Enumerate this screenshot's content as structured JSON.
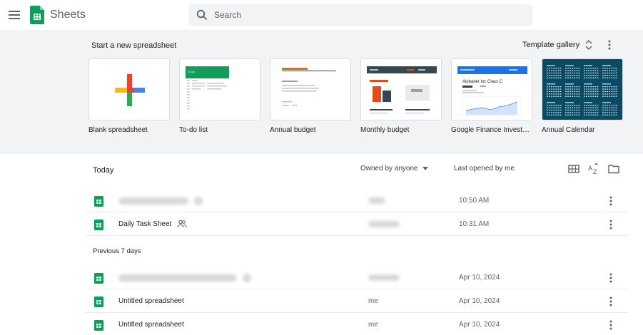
{
  "header": {
    "app_name": "Sheets",
    "search_placeholder": "Search"
  },
  "templates": {
    "title": "Start a new spreadsheet",
    "gallery_label": "Template gallery",
    "items": [
      {
        "label": "Blank spreadsheet"
      },
      {
        "label": "To-do list"
      },
      {
        "label": "Annual budget"
      },
      {
        "label": "Monthly budget"
      },
      {
        "label": "Google Finance Invest…"
      },
      {
        "label": "Annual Calendar"
      }
    ],
    "thumb_text": {
      "todo_title": "To-do",
      "finance_title": "Alphabet Inc Class C"
    }
  },
  "list": {
    "section_today": "Today",
    "owner_filter": "Owned by anyone",
    "sort_label": "Last opened by me",
    "section_previous": "Previous 7 days",
    "rows": [
      {
        "name": "",
        "owner": "",
        "date": "10:50 AM",
        "blurred": true
      },
      {
        "name": "Daily Task Sheet",
        "owner": "",
        "date": "10:31 AM",
        "blurred": false,
        "shared": true
      },
      {
        "name": "",
        "owner": "",
        "date": "Apr 10, 2024",
        "blurred": true
      },
      {
        "name": "Untitled spreadsheet",
        "owner": "me",
        "date": "Apr 10, 2024",
        "blurred": false
      },
      {
        "name": "Untitled spreadsheet",
        "owner": "me",
        "date": "Apr 10, 2024",
        "blurred": false
      }
    ]
  },
  "colors": {
    "sheets_green": "#0f9d58",
    "band_bg": "#f1f3f4"
  },
  "icons": [
    "menu-icon",
    "sheets-logo-icon",
    "search-icon",
    "unfold-icon",
    "more-vert-icon",
    "grid-view-icon",
    "sort-az-icon",
    "folder-icon",
    "people-icon",
    "sheets-file-icon",
    "dropdown-arrow-icon"
  ]
}
